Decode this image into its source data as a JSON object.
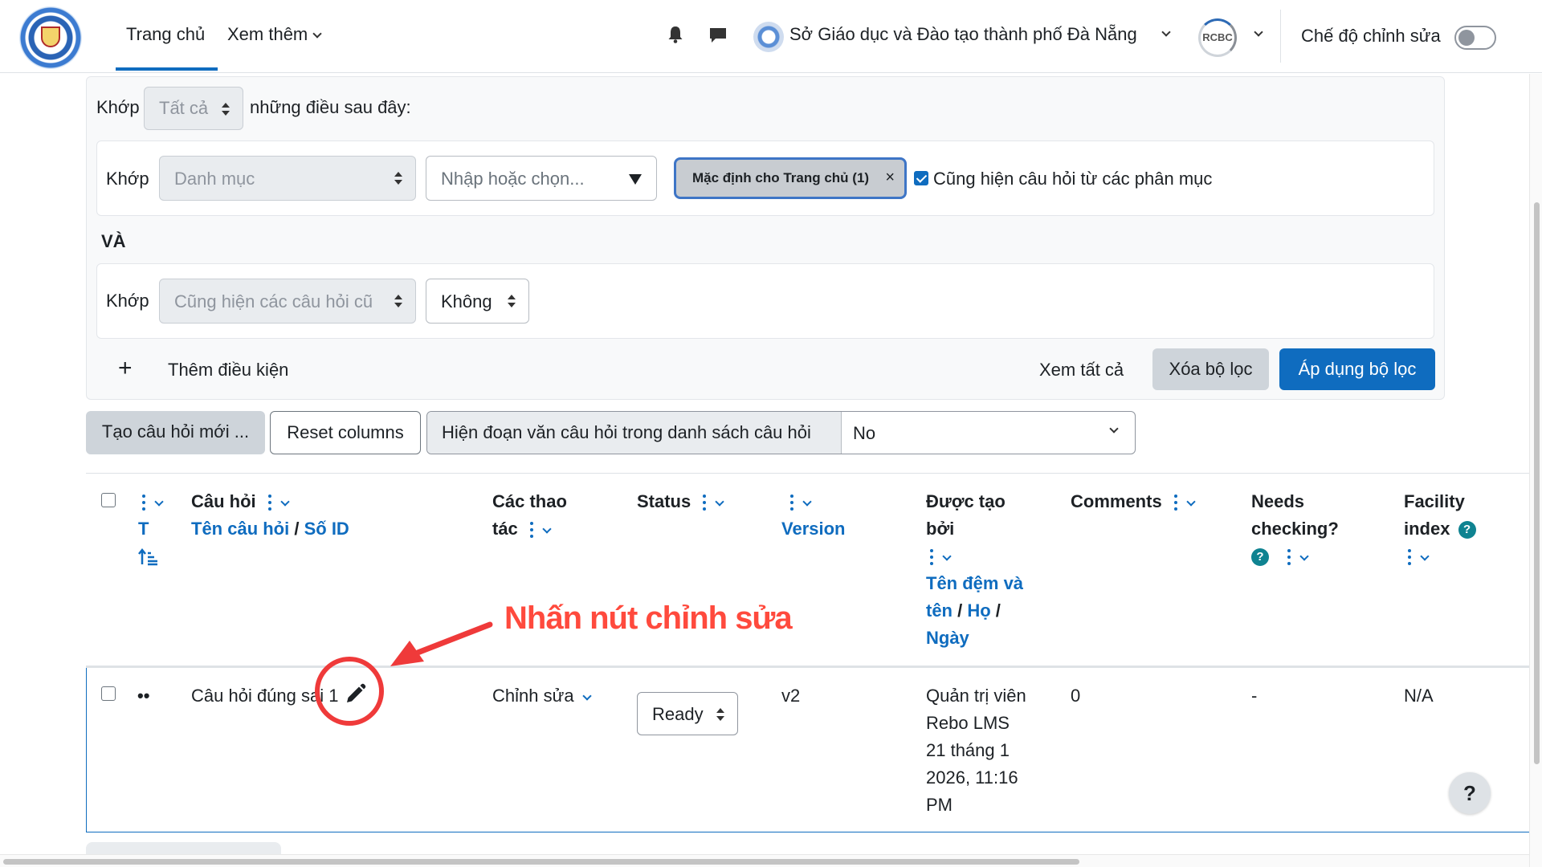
{
  "navbar": {
    "home": "Trang chủ",
    "more": "Xem thêm",
    "org_name": "Sở Giáo dục và Đào tạo thành phố Đà Nẵng",
    "user_initials": "RCBC",
    "edit_mode_label": "Chế độ chỉnh sửa",
    "edit_mode_on": false
  },
  "filter": {
    "match_label": "Khớp",
    "match_all_value": "Tất cả",
    "match_all_suffix": "những điều sau đây:",
    "condition1": {
      "match_label": "Khớp",
      "type_value": "Danh mục",
      "search_placeholder": "Nhập hoặc chọn...",
      "selected_tag": "Mặc định cho Trang chủ (1)",
      "include_subcategories_label": "Cũng hiện câu hỏi từ các phân mục",
      "include_subcategories_checked": true
    },
    "and_label": "VÀ",
    "condition2": {
      "match_label": "Khớp",
      "type_value": "Cũng hiện các câu hỏi cũ",
      "value": "Không"
    },
    "add_condition": "Thêm điều kiện",
    "show_all": "Xem tất cả",
    "clear": "Xóa bộ lọc",
    "apply": "Áp dụng bộ lọc"
  },
  "toolbar": {
    "create_question": "Tạo câu hỏi mới ...",
    "reset_columns": "Reset columns",
    "show_text_label": "Hiện đoạn văn câu hỏi trong danh sách câu hỏi",
    "show_text_value": "No"
  },
  "table": {
    "headers": {
      "type_letter": "T",
      "question": "Câu hỏi",
      "question_name_link": "Tên câu hỏi",
      "question_id_link": "Số ID",
      "actions_line1": "Các thao",
      "actions_line2": "tác",
      "status": "Status",
      "version": "Version",
      "created_by_line1": "Được tạo",
      "created_by_line2": "bởi",
      "created_firstname_line1": "Tên đệm và",
      "created_firstname_line2": "tên",
      "created_lastname": "Họ",
      "created_date": "Ngày",
      "comments": "Comments",
      "needs_checking_line1": "Needs",
      "needs_checking_line2": "checking?",
      "facility_line1": "Facility",
      "facility_line2": "index"
    },
    "rows": [
      {
        "type_icon": "••",
        "name": "Câu hỏi đúng sai 1",
        "actions": "Chỉnh sửa",
        "status": "Ready",
        "version": "v2",
        "created_by_line1": "Quản trị viên",
        "created_by_line2": "Rebo LMS",
        "created_by_line3": "21 tháng 1",
        "created_by_line4": "2026, 11:16",
        "created_by_line5": "PM",
        "comments": "0",
        "needs_checking": "-",
        "facility_index": "N/A"
      }
    ]
  },
  "annotation": {
    "text": "Nhấn nút chỉnh sửa",
    "color": "#ff4a3d"
  },
  "help_fab": "?"
}
